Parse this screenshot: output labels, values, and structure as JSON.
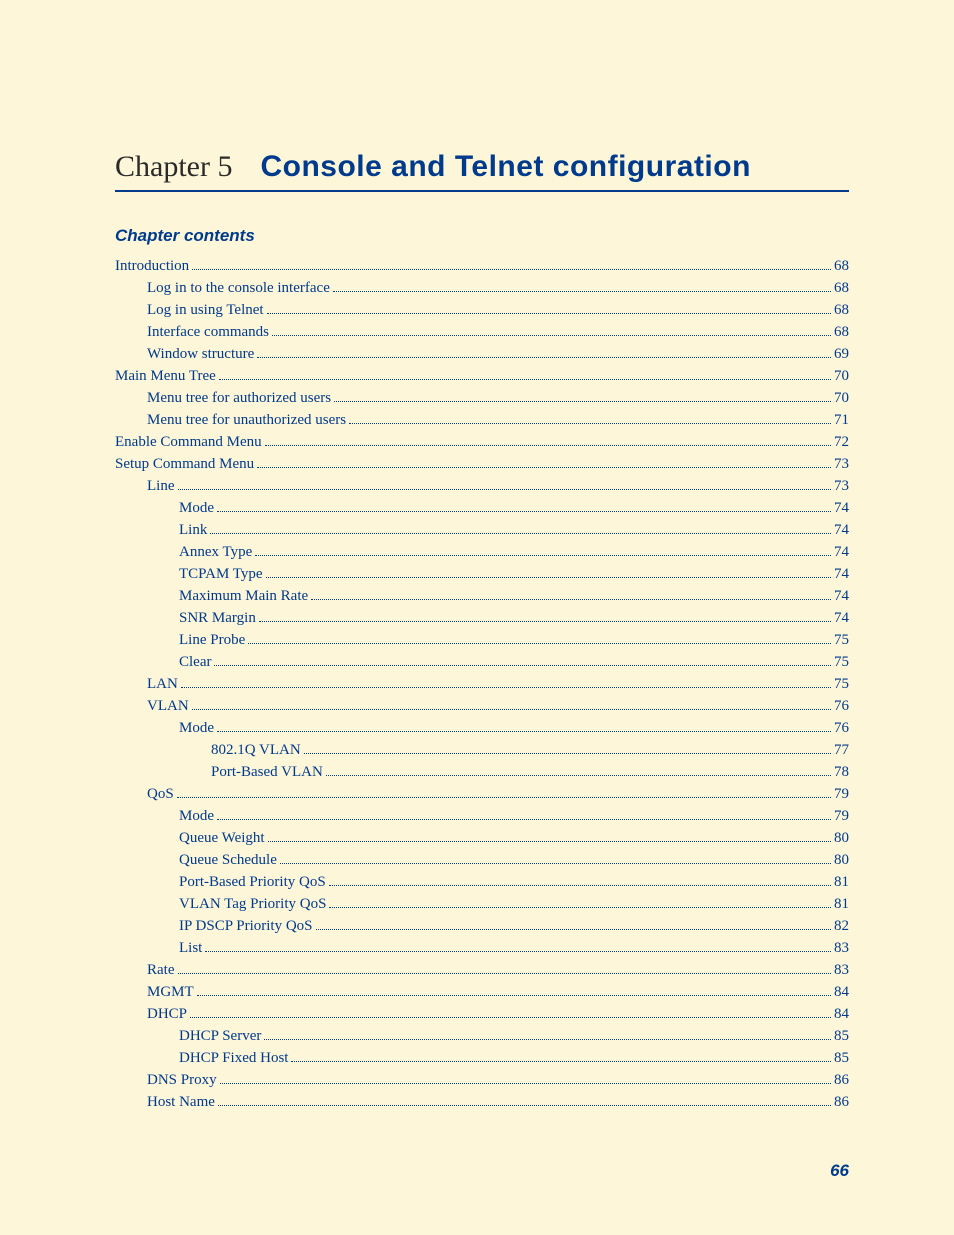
{
  "chapter_label": "Chapter 5",
  "chapter_title": "Console and Telnet configuration",
  "section_heading": "Chapter contents",
  "page_number": "66",
  "toc": [
    {
      "title": "Introduction",
      "page": "68",
      "indent": 0
    },
    {
      "title": "Log in to the console interface ",
      "page": "68",
      "indent": 1
    },
    {
      "title": "Log in using Telnet ",
      "page": "68",
      "indent": 1
    },
    {
      "title": "Interface commands ",
      "page": "68",
      "indent": 1
    },
    {
      "title": "Window structure ",
      "page": "69",
      "indent": 1
    },
    {
      "title": "Main Menu Tree",
      "page": "70",
      "indent": 0
    },
    {
      "title": "Menu tree for authorized users ",
      "page": "70",
      "indent": 1
    },
    {
      "title": "Menu tree for unauthorized users ",
      "page": "71",
      "indent": 1
    },
    {
      "title": "Enable Command Menu",
      "page": "72",
      "indent": 0
    },
    {
      "title": "Setup Command Menu",
      "page": "73",
      "indent": 0
    },
    {
      "title": "Line ",
      "page": "73",
      "indent": 1
    },
    {
      "title": "Mode ",
      "page": "74",
      "indent": 2
    },
    {
      "title": "Link ",
      "page": "74",
      "indent": 2
    },
    {
      "title": "Annex Type ",
      "page": "74",
      "indent": 2
    },
    {
      "title": "TCPAM Type ",
      "page": "74",
      "indent": 2
    },
    {
      "title": "Maximum Main Rate ",
      "page": "74",
      "indent": 2
    },
    {
      "title": "SNR Margin ",
      "page": "74",
      "indent": 2
    },
    {
      "title": "Line Probe ",
      "page": "75",
      "indent": 2
    },
    {
      "title": "Clear ",
      "page": "75",
      "indent": 2
    },
    {
      "title": "LAN ",
      "page": "75",
      "indent": 1
    },
    {
      "title": "VLAN ",
      "page": "76",
      "indent": 1
    },
    {
      "title": "Mode ",
      "page": "76",
      "indent": 2
    },
    {
      "title": "802.1Q VLAN",
      "page": " 77",
      "indent": 3
    },
    {
      "title": "Port-Based VLAN ",
      "page": " 78",
      "indent": 3
    },
    {
      "title": "QoS ",
      "page": "79",
      "indent": 1
    },
    {
      "title": "Mode ",
      "page": "79",
      "indent": 2
    },
    {
      "title": "Queue Weight ",
      "page": "80",
      "indent": 2
    },
    {
      "title": "Queue Schedule ",
      "page": "80",
      "indent": 2
    },
    {
      "title": "Port-Based Priority QoS ",
      "page": "81",
      "indent": 2
    },
    {
      "title": "VLAN Tag Priority QoS ",
      "page": "81",
      "indent": 2
    },
    {
      "title": "IP DSCP Priority QoS ",
      "page": "82",
      "indent": 2
    },
    {
      "title": "List ",
      "page": "83",
      "indent": 2
    },
    {
      "title": "Rate ",
      "page": "83",
      "indent": 1
    },
    {
      "title": "MGMT ",
      "page": "84",
      "indent": 1
    },
    {
      "title": "DHCP ",
      "page": "84",
      "indent": 1
    },
    {
      "title": "DHCP Server ",
      "page": "85",
      "indent": 2
    },
    {
      "title": "DHCP Fixed Host ",
      "page": "85",
      "indent": 2
    },
    {
      "title": "DNS Proxy ",
      "page": "86",
      "indent": 1
    },
    {
      "title": "Host Name ",
      "page": "86",
      "indent": 1
    }
  ]
}
